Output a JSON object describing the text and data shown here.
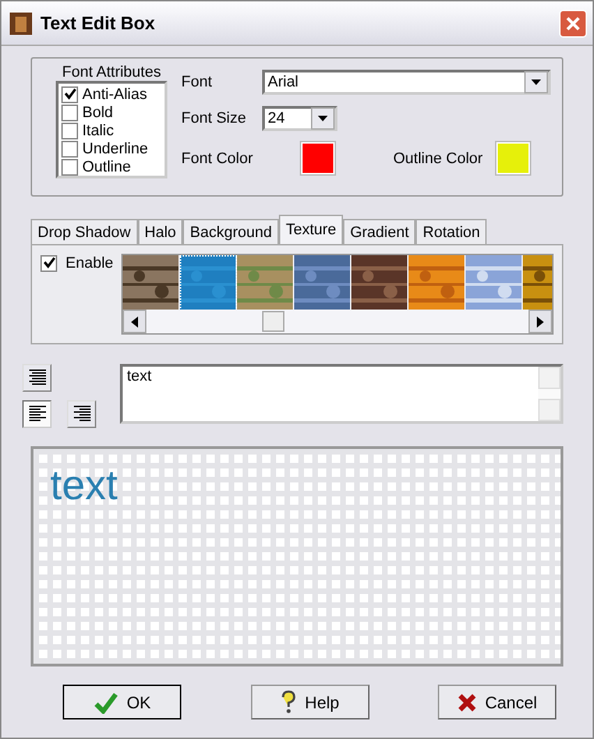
{
  "window": {
    "title": "Text Edit Box"
  },
  "font_attributes": {
    "title": "Font Attributes",
    "items": [
      {
        "label": "Anti-Alias",
        "checked": true
      },
      {
        "label": "Bold",
        "checked": false
      },
      {
        "label": "Italic",
        "checked": false
      },
      {
        "label": "Underline",
        "checked": false
      },
      {
        "label": "Outline",
        "checked": false
      }
    ]
  },
  "font": {
    "label": "Font",
    "value": "Arial"
  },
  "font_size": {
    "label": "Font Size",
    "value": "24"
  },
  "font_color": {
    "label": "Font Color",
    "color": "#ff0000"
  },
  "outline_color": {
    "label": "Outline Color",
    "color": "#e6f00a"
  },
  "tabs": [
    {
      "label": "Drop Shadow",
      "selected": false
    },
    {
      "label": "Halo",
      "selected": false
    },
    {
      "label": "Background",
      "selected": false
    },
    {
      "label": "Texture",
      "selected": true
    },
    {
      "label": "Gradient",
      "selected": false
    },
    {
      "label": "Rotation",
      "selected": false
    }
  ],
  "texture_panel": {
    "enable": {
      "label": "Enable",
      "checked": true
    },
    "textures": [
      {
        "kind": "picture",
        "selected": false
      },
      {
        "kind": "picture",
        "selected": true
      },
      {
        "kind": "picture",
        "selected": false
      },
      {
        "kind": "picture",
        "selected": false
      },
      {
        "kind": "picture",
        "selected": false
      },
      {
        "kind": "picture",
        "selected": false
      },
      {
        "kind": "picture",
        "selected": false
      },
      {
        "kind": "picture",
        "selected": false
      }
    ]
  },
  "align_buttons": [
    {
      "kind": "center",
      "selected": false
    },
    {
      "kind": "left",
      "selected": true
    },
    {
      "kind": "right",
      "selected": false
    }
  ],
  "text_input": {
    "value": "text"
  },
  "preview": {
    "text": "text"
  },
  "buttons": [
    {
      "kind": "ok",
      "label": "OK"
    },
    {
      "kind": "help",
      "label": "Help"
    },
    {
      "kind": "cancel",
      "label": "Cancel"
    }
  ]
}
